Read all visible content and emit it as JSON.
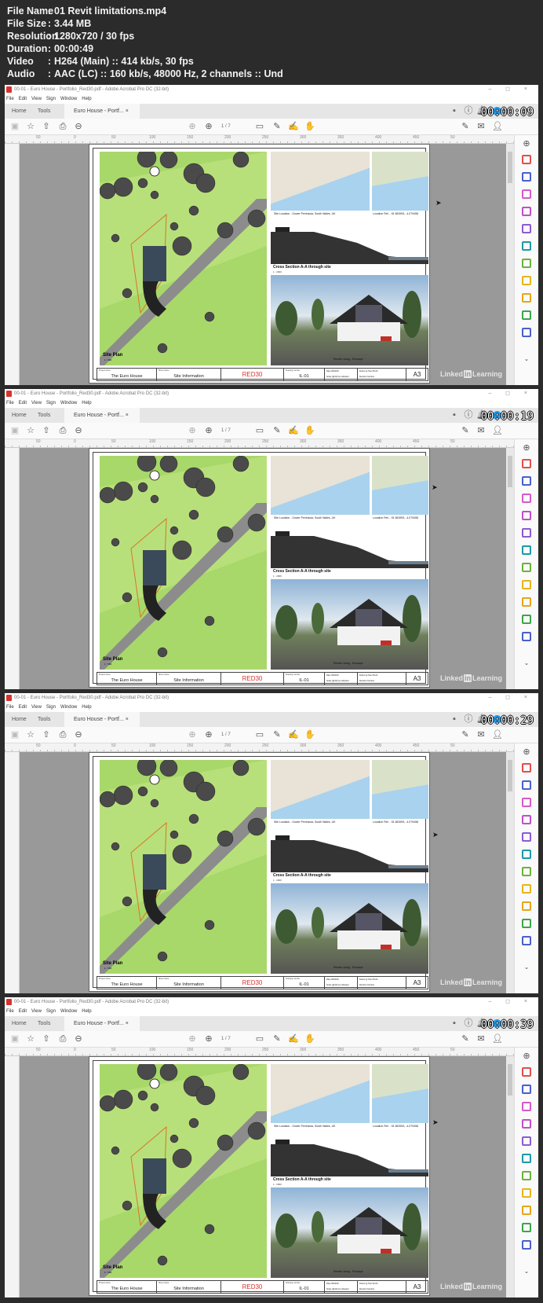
{
  "file_info": [
    {
      "label": "File Name",
      "value": "01 Revit limitations.mp4"
    },
    {
      "label": "File Size",
      "value": "3.44 MB"
    },
    {
      "label": "Resolution",
      "value": "1280x720 / 30 fps"
    },
    {
      "label": "Duration",
      "value": "00:00:49"
    },
    {
      "label": "Video",
      "value": "H264 (Main) :: 414 kb/s, 30 fps"
    },
    {
      "label": "Audio",
      "value": "AAC (LC) :: 160 kb/s, 48000 Hz, 2 channels :: Und"
    }
  ],
  "separator": ":",
  "app": {
    "window_title": "00-01 - Euro House - Portfolio_Red30.pdf - Adobe Acrobat Pro DC (32-bit)",
    "window_controls": "– ◻ ×",
    "menu": [
      "File",
      "Edit",
      "View",
      "Sign",
      "Window",
      "Help"
    ],
    "tabs": {
      "home": "Home",
      "tools": "Tools",
      "document": "Euro House - Portf...",
      "close": "×"
    },
    "page_indicator": "1 / 7",
    "ruler_ticks": [
      "50",
      "0",
      "50",
      "100",
      "150",
      "200",
      "250",
      "300",
      "350",
      "400",
      "450",
      "50"
    ],
    "right_panel_icons": [
      {
        "name": "create-pdf",
        "color": "#e0504a"
      },
      {
        "name": "export-pdf",
        "color": "#4a5fd0"
      },
      {
        "name": "organize-pages",
        "color": "#d65ac9"
      },
      {
        "name": "edit-pdf",
        "color": "#c04fc9"
      },
      {
        "name": "fill-sign",
        "color": "#8e5ad0"
      },
      {
        "name": "send-for-review",
        "color": "#1d9aa6"
      },
      {
        "name": "compare-files",
        "color": "#6bb33a"
      },
      {
        "name": "scan-ocr",
        "color": "#e7b51c"
      },
      {
        "name": "comment",
        "color": "#e7a51c"
      },
      {
        "name": "print-production",
        "color": "#3aa648"
      },
      {
        "name": "protect",
        "color": "#4a5fd0"
      }
    ],
    "watermark": {
      "linked": "Linked",
      "in": "in",
      "learning": "Learning"
    }
  },
  "sheet": {
    "map_caption_left": "Site Location - Gower Peninsula, South Wales, UK",
    "map_caption_right": "Location Ref. - 51.563993, -4.079458",
    "section_title": "Cross Section A-A through site",
    "section_scale": "1 : 2000",
    "render_caption": "Render using - Enscape",
    "site_plan_title": "Site Plan",
    "site_plan_scale": "1 : 500",
    "title_block": {
      "project_label": "Project name",
      "project": "The Euro House",
      "sheet_label": "Sheet name",
      "sheet": "Site Information",
      "logo": "RED30",
      "drawing_label": "Drawing number",
      "drawing": "IL-01",
      "date_label": "Date",
      "date": "06/02/20",
      "scale_label": "Scale (@A3)",
      "scale": "As indicated",
      "drawn_label": "Drawn by",
      "drawn": "Paul Smith",
      "revision_label": "Revision Number",
      "size": "A3"
    }
  },
  "frames": [
    {
      "timestamp": "00:00:09"
    },
    {
      "timestamp": "00:00:19"
    },
    {
      "timestamp": "00:00:29"
    },
    {
      "timestamp": "00:00:39"
    }
  ]
}
